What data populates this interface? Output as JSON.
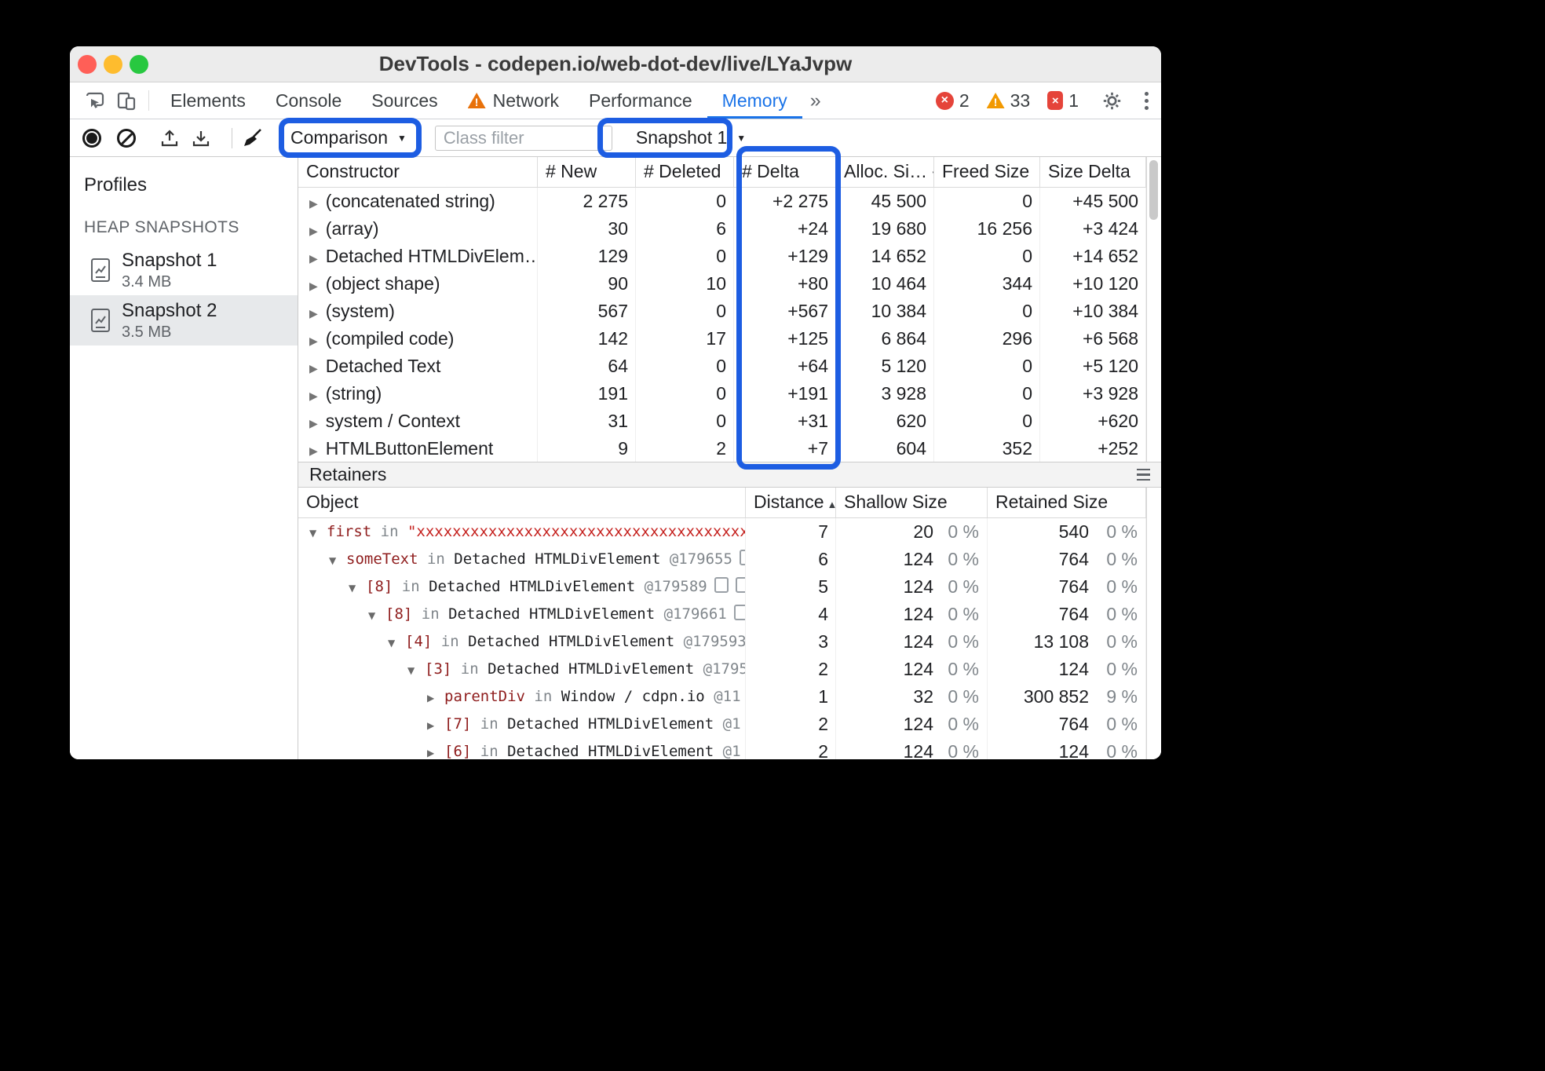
{
  "theme": {
    "highlight_blue": "#1d5de2",
    "accent_blue": "#1a73e8",
    "error_red": "#e5443a",
    "warning_orange": "#f29900"
  },
  "window": {
    "title": "DevTools - codepen.io/web-dot-dev/live/LYaJvpw"
  },
  "icons": {
    "more_tabs": "»",
    "dropdown": "▼",
    "sort_desc": "▼",
    "sort_asc": "▲",
    "expanded": "▼",
    "collapsed": "▶",
    "warning_mark": "!",
    "error_mark": "×"
  },
  "tabs": {
    "items": [
      {
        "label": "Elements"
      },
      {
        "label": "Console"
      },
      {
        "label": "Sources"
      },
      {
        "label": "Network",
        "warning": true
      },
      {
        "label": "Performance"
      },
      {
        "label": "Memory",
        "active": true
      }
    ],
    "badges": {
      "errors": "2",
      "warnings": "33",
      "issues": "1"
    }
  },
  "toolbar": {
    "view_label": "Comparison",
    "filter_placeholder": "Class filter",
    "base_snapshot_label": "Snapshot 1"
  },
  "sidebar": {
    "profiles_label": "Profiles",
    "section_label": "HEAP SNAPSHOTS",
    "snapshots": [
      {
        "name": "Snapshot 1",
        "size": "3.4 MB",
        "selected": false
      },
      {
        "name": "Snapshot 2",
        "size": "3.5 MB",
        "selected": true
      }
    ]
  },
  "comparison_grid": {
    "columns": {
      "constructor": "Constructor",
      "new": "# New",
      "deleted": "# Deleted",
      "delta": "# Delta",
      "alloc": "Alloc. Si…",
      "freed": "Freed Size",
      "size_delta": "Size Delta"
    },
    "rows": [
      {
        "constructor": "(concatenated string)",
        "new": "2 275",
        "deleted": "0",
        "delta": "+2 275",
        "alloc": "45 500",
        "freed": "0",
        "size_delta": "+45 500"
      },
      {
        "constructor": "(array)",
        "new": "30",
        "deleted": "6",
        "delta": "+24",
        "alloc": "19 680",
        "freed": "16 256",
        "size_delta": "+3 424"
      },
      {
        "constructor": "Detached HTMLDivElem…",
        "new": "129",
        "deleted": "0",
        "delta": "+129",
        "alloc": "14 652",
        "freed": "0",
        "size_delta": "+14 652"
      },
      {
        "constructor": "(object shape)",
        "new": "90",
        "deleted": "10",
        "delta": "+80",
        "alloc": "10 464",
        "freed": "344",
        "size_delta": "+10 120"
      },
      {
        "constructor": "(system)",
        "new": "567",
        "deleted": "0",
        "delta": "+567",
        "alloc": "10 384",
        "freed": "0",
        "size_delta": "+10 384"
      },
      {
        "constructor": "(compiled code)",
        "new": "142",
        "deleted": "17",
        "delta": "+125",
        "alloc": "6 864",
        "freed": "296",
        "size_delta": "+6 568"
      },
      {
        "constructor": "Detached Text",
        "new": "64",
        "deleted": "0",
        "delta": "+64",
        "alloc": "5 120",
        "freed": "0",
        "size_delta": "+5 120"
      },
      {
        "constructor": "(string)",
        "new": "191",
        "deleted": "0",
        "delta": "+191",
        "alloc": "3 928",
        "freed": "0",
        "size_delta": "+3 928"
      },
      {
        "constructor": "system / Context",
        "new": "31",
        "deleted": "0",
        "delta": "+31",
        "alloc": "620",
        "freed": "0",
        "size_delta": "+620"
      },
      {
        "constructor": "HTMLButtonElement",
        "new": "9",
        "deleted": "2",
        "delta": "+7",
        "alloc": "604",
        "freed": "352",
        "size_delta": "+252"
      }
    ]
  },
  "retainers": {
    "title": "Retainers",
    "columns": {
      "object": "Object",
      "distance": "Distance",
      "shallow": "Shallow Size",
      "retained": "Retained Size"
    },
    "rows": [
      {
        "depth": 0,
        "expanded": true,
        "name": "first",
        "object": "\"xxxxxxxxxxxxxxxxxxxxxxxxxxxxxxxxxxxxxxxxxxxxx",
        "string": true,
        "distance": "7",
        "shallow": "20",
        "shallow_pct": "0 %",
        "retained": "540",
        "retained_pct": "0 %"
      },
      {
        "depth": 1,
        "expanded": true,
        "name": "someText",
        "object": "Detached HTMLDivElement",
        "at": "@179655",
        "icons": 1,
        "distance": "6",
        "shallow": "124",
        "shallow_pct": "0 %",
        "retained": "764",
        "retained_pct": "0 %"
      },
      {
        "depth": 2,
        "expanded": true,
        "name": "[8]",
        "object": "Detached HTMLDivElement",
        "at": "@179589",
        "icons": 2,
        "distance": "5",
        "shallow": "124",
        "shallow_pct": "0 %",
        "retained": "764",
        "retained_pct": "0 %"
      },
      {
        "depth": 3,
        "expanded": true,
        "name": "[8]",
        "object": "Detached HTMLDivElement",
        "at": "@179661",
        "icons": 1,
        "distance": "4",
        "shallow": "124",
        "shallow_pct": "0 %",
        "retained": "764",
        "retained_pct": "0 %"
      },
      {
        "depth": 4,
        "expanded": true,
        "name": "[4]",
        "object": "Detached HTMLDivElement",
        "at": "@179593",
        "distance": "3",
        "shallow": "124",
        "shallow_pct": "0 %",
        "retained": "13 108",
        "retained_pct": "0 %"
      },
      {
        "depth": 5,
        "expanded": true,
        "name": "[3]",
        "object": "Detached HTMLDivElement",
        "at": "@1795",
        "distance": "2",
        "shallow": "124",
        "shallow_pct": "0 %",
        "retained": "124",
        "retained_pct": "0 %"
      },
      {
        "depth": 6,
        "expanded": false,
        "name": "parentDiv",
        "object": "Window / cdpn.io",
        "at": "@11",
        "distance": "1",
        "shallow": "32",
        "shallow_pct": "0 %",
        "retained": "300 852",
        "retained_pct": "9 %"
      },
      {
        "depth": 6,
        "expanded": false,
        "name": "[7]",
        "object": "Detached HTMLDivElement",
        "at": "@1",
        "distance": "2",
        "shallow": "124",
        "shallow_pct": "0 %",
        "retained": "764",
        "retained_pct": "0 %"
      },
      {
        "depth": 6,
        "expanded": false,
        "name": "[6]",
        "object": "Detached HTMLDivElement",
        "at": "@1",
        "distance": "2",
        "shallow": "124",
        "shallow_pct": "0 %",
        "retained": "124",
        "retained_pct": "0 %"
      }
    ]
  }
}
